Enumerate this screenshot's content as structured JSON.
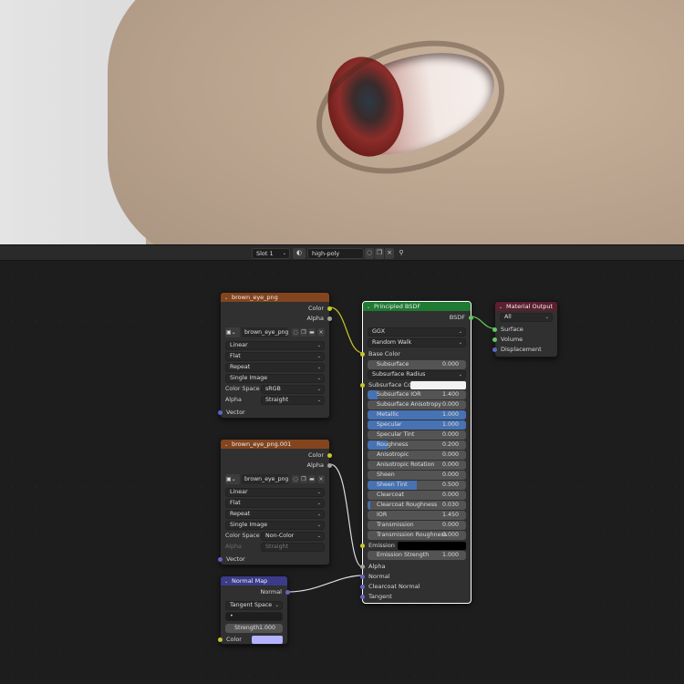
{
  "header": {
    "slot": "Slot 1",
    "material_name": "high-poly"
  },
  "nodes": {
    "image1": {
      "title": "brown_eye_png",
      "outputs": [
        "Color",
        "Alpha"
      ],
      "image_name": "brown_eye_png",
      "interpolation": "Linear",
      "projection": "Flat",
      "extension": "Repeat",
      "source": "Single Image",
      "color_space_label": "Color Space",
      "color_space": "sRGB",
      "alpha_label": "Alpha",
      "alpha_mode": "Straight",
      "input": "Vector"
    },
    "image2": {
      "title": "brown_eye_png.001",
      "outputs": [
        "Color",
        "Alpha"
      ],
      "image_name": "brown_eye_png.0...",
      "interpolation": "Linear",
      "projection": "Flat",
      "extension": "Repeat",
      "source": "Single Image",
      "color_space_label": "Color Space",
      "color_space": "Non-Color",
      "alpha_label": "Alpha",
      "alpha_mode": "Straight",
      "input": "Vector"
    },
    "normal_map": {
      "title": "Normal Map",
      "output": "Normal",
      "space": "Tangent Space",
      "uv": "•",
      "strength_label": "Strength",
      "strength": "1.000",
      "color_label": "Color",
      "color_hex": "#b3b3ff"
    },
    "bsdf": {
      "title": "Principled BSDF",
      "output": "BSDF",
      "distribution": "GGX",
      "subsurface_method": "Random Walk",
      "base_color": "Base Color",
      "subsurface": {
        "label": "Subsurface",
        "value": "0.000"
      },
      "subsurface_radius": "Subsurface Radius",
      "subsurface_color": "Subsurface Colo",
      "params": [
        {
          "label": "Subsurface IOR",
          "value": "1.400",
          "fill": 0.1
        },
        {
          "label": "Subsurface Anisotropy",
          "value": "0.000",
          "fill": 0
        },
        {
          "label": "Metallic",
          "value": "1.000",
          "fill": 1
        },
        {
          "label": "Specular",
          "value": "1.000",
          "fill": 1
        },
        {
          "label": "Specular Tint",
          "value": "0.000",
          "fill": 0
        },
        {
          "label": "Roughness",
          "value": "0.200",
          "fill": 0.2
        },
        {
          "label": "Anisotropic",
          "value": "0.000",
          "fill": 0
        },
        {
          "label": "Anisotropic Rotation",
          "value": "0.000",
          "fill": 0
        },
        {
          "label": "Sheen",
          "value": "0.000",
          "fill": 0
        },
        {
          "label": "Sheen Tint",
          "value": "0.500",
          "fill": 0.5
        },
        {
          "label": "Clearcoat",
          "value": "0.000",
          "fill": 0
        },
        {
          "label": "Clearcoat Roughness",
          "value": "0.030",
          "fill": 0.03
        },
        {
          "label": "IOR",
          "value": "1.450",
          "fill": 0
        },
        {
          "label": "Transmission",
          "value": "0.000",
          "fill": 0
        },
        {
          "label": "Transmission Roughness",
          "value": "0.000",
          "fill": 0
        }
      ],
      "emission": "Emission",
      "emission_strength": {
        "label": "Emission Strength",
        "value": "1.000"
      },
      "inputs_bottom": [
        "Alpha",
        "Normal",
        "Clearcoat Normal",
        "Tangent"
      ]
    },
    "output": {
      "title": "Material Output",
      "target": "All",
      "inputs": [
        "Surface",
        "Volume",
        "Displacement"
      ]
    }
  },
  "colors": {
    "image_header": "#83451e",
    "shader_header": "#1f7a32",
    "vector_header": "#3b3b8a",
    "output_header": "#5a2030",
    "slider_accent": "#4772b3"
  }
}
